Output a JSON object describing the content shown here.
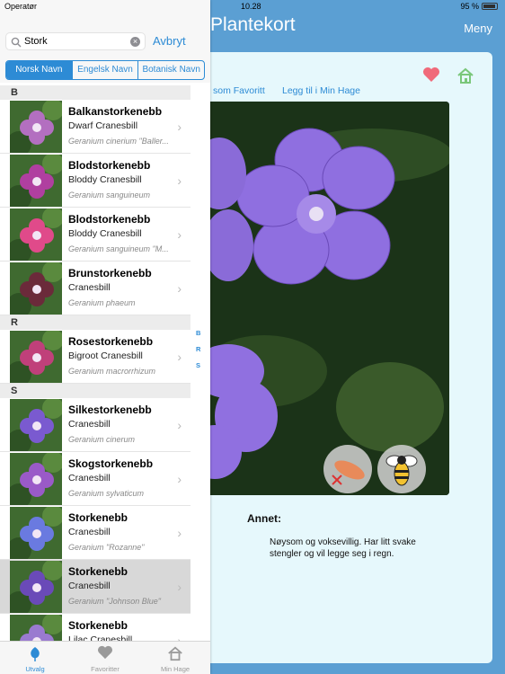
{
  "status": {
    "carrier": "Operatør",
    "time": "10.28",
    "battery": "95 %"
  },
  "detail": {
    "title": "Plantekort",
    "menu_label": "Meny",
    "add_favorite_link": "som Favoritt",
    "add_garden_link": "Legg til i Min Hage",
    "annet_label": "Annet:",
    "annet_text": "Nøysom og voksevillig. Har litt svake stengler og vil legge seg i regn."
  },
  "search": {
    "value": "Stork",
    "cancel_label": "Avbryt"
  },
  "segments": [
    {
      "label": "Norsk Navn",
      "active": true
    },
    {
      "label": "Engelsk Navn",
      "active": false
    },
    {
      "label": "Botanisk Navn",
      "active": false
    }
  ],
  "sections": [
    "B",
    "R",
    "S"
  ],
  "index_letters": [
    "B",
    "R",
    "S"
  ],
  "rows": [
    {
      "norsk": "Balkanstorkenebb",
      "english": "Dwarf Cranesbill",
      "botanical": "Geranium cinerium \"Baller...",
      "color": "#b36fc0",
      "selected": false
    },
    {
      "norsk": "Blodstorkenebb",
      "english": "Bloddy Cranesbill",
      "botanical": "Geranium sanguineum",
      "color": "#b03fa0",
      "selected": false
    },
    {
      "norsk": "Blodstorkenebb",
      "english": "Bloddy Cranesbill",
      "botanical": "Geranium sanguineum \"M...",
      "color": "#e04a8a",
      "selected": false
    },
    {
      "norsk": "Brunstorkenebb",
      "english": "Cranesbill",
      "botanical": "Geranium phaeum",
      "color": "#6b2a3a",
      "selected": false
    },
    {
      "norsk": "Rosestorkenebb",
      "english": "Bigroot Cranesbill",
      "botanical": "Geranium macrorrhizum",
      "color": "#c0407a",
      "selected": false
    },
    {
      "norsk": "Silkestorkenebb",
      "english": "Cranesbill",
      "botanical": "Geranium cinerum",
      "color": "#7a5ad0",
      "selected": false
    },
    {
      "norsk": "Skogstorkenebb",
      "english": "Cranesbill",
      "botanical": "Geranium sylvaticum",
      "color": "#9a5ac8",
      "selected": false
    },
    {
      "norsk": "Storkenebb",
      "english": "Cranesbill",
      "botanical": "Geranium  \"Rozanne\"",
      "color": "#6a7ae0",
      "selected": false
    },
    {
      "norsk": "Storkenebb",
      "english": "Cranesbill",
      "botanical": "Geranium \"Johnson Blue\"",
      "color": "#6a4ab8",
      "selected": true
    },
    {
      "norsk": "Storkenebb",
      "english": "Lilac Cranesbill",
      "botanical": "",
      "color": "#9a7ad0",
      "selected": false
    }
  ],
  "tabs": [
    {
      "label": "Utvalg",
      "icon": "flower-icon",
      "active": true
    },
    {
      "label": "Favoritter",
      "icon": "heart-icon",
      "active": false
    },
    {
      "label": "Min Hage",
      "icon": "house-icon",
      "active": false
    }
  ],
  "colors": {
    "accent": "#2d8bd5",
    "header": "#5b9fd3",
    "card": "#e6f8fc",
    "heart": "#f06a7a",
    "home": "#7ac77a"
  }
}
